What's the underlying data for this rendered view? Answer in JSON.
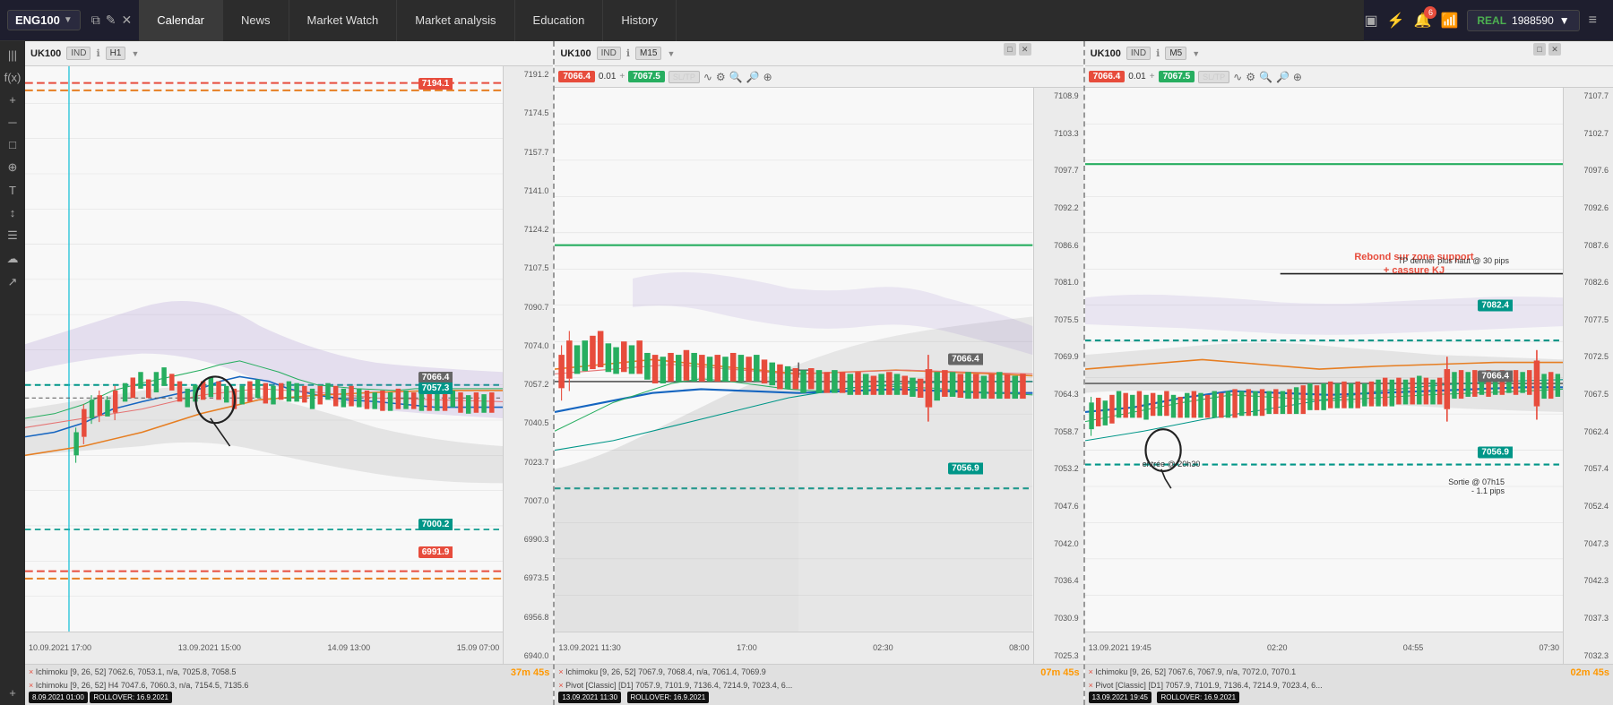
{
  "topbar": {
    "instrument": "ENG100",
    "nav_items": [
      "Calendar",
      "News",
      "Market Watch",
      "Market analysis",
      "Education",
      "History"
    ],
    "account_type": "REAL",
    "account_balance": "1988590",
    "notification_count": "6"
  },
  "charts": [
    {
      "id": "chart1",
      "symbol": "UK100",
      "type": "IND",
      "timeframe": "H1",
      "bid": "",
      "spread": "",
      "ask": "",
      "has_trade_toolbar": false,
      "y_labels": [
        "7191.2",
        "7174.5",
        "7157.7",
        "7141.0",
        "7124.2",
        "7107.5",
        "7090.7",
        "7074.0",
        "7057.2",
        "7040.5",
        "7023.7",
        "7007.0",
        "6990.3",
        "6973.5",
        "6956.8",
        "6940.0"
      ],
      "x_labels": [
        "10.09.2021 17:00",
        "13.09.2021 15:00",
        "14.09.13:00",
        "15.09 07:00"
      ],
      "price_labels": [
        {
          "value": "7194.1",
          "type": "red",
          "top_pct": 5
        },
        {
          "value": "7057.3",
          "type": "teal",
          "top_pct": 56
        },
        {
          "value": "7000.2",
          "type": "teal-dark",
          "top_pct": 82
        },
        {
          "value": "6991.9",
          "type": "red",
          "top_pct": 87
        }
      ],
      "current_price": "7066.4",
      "footer": [
        "× Ichimoku [9, 26, 52] 7062.6, 7053.1, n/a, 7025.8, 7058.5",
        "× Ichimoku [9, 26, 52] H4 7047.6, 7060.3, n/a, 7154.5, 7135.6"
      ],
      "footer_date": "8.09.2021 01:00",
      "footer_rollover": "ROLLOVER: 16.9.2021",
      "timer": "37m 45s",
      "timer_label": "37m 45s"
    },
    {
      "id": "chart2",
      "symbol": "UK100",
      "type": "IND",
      "timeframe": "M15",
      "bid": "7066.4",
      "spread": "0.01",
      "ask": "7067.5",
      "has_trade_toolbar": true,
      "y_labels": [
        "7108.9",
        "7103.3",
        "7097.7",
        "7092.2",
        "7086.6",
        "7081.0",
        "7075.5",
        "7069.9",
        "7064.3",
        "7058.7",
        "7053.2",
        "7047.6",
        "7042.0",
        "7036.4",
        "7030.9",
        "7025.3"
      ],
      "x_labels": [
        "13.09.2021 11:30",
        "17:00",
        "02:30",
        "08:00"
      ],
      "price_labels": [
        {
          "value": "7066.4",
          "type": "gray",
          "top_pct": 56
        },
        {
          "value": "7056.9",
          "type": "teal",
          "top_pct": 67
        }
      ],
      "footer": [
        "× Ichimoku [9, 26, 52] 7067.9, 7068.4, n/a, 7061.4, 7069.9",
        "× Pivot [Classic] [D1] 7057.9, 7101.9, 7136.4, 7214.9, 7023.4, 6..."
      ],
      "footer_date": "13.09.2021 11:30",
      "footer_rollover": "ROLLOVER: 16.9.2021",
      "timer": "07m 45s"
    },
    {
      "id": "chart3",
      "symbol": "UK100",
      "type": "IND",
      "timeframe": "M5",
      "bid": "7066.4",
      "spread": "0.01",
      "ask": "7067.5",
      "has_trade_toolbar": true,
      "y_labels": [
        "7107.7",
        "7102.7",
        "7097.6",
        "7092.6",
        "7087.6",
        "7082.6",
        "7077.5",
        "7072.5",
        "7067.5",
        "7062.4",
        "7057.4",
        "7052.4",
        "7047.3",
        "7042.3",
        "7037.3",
        "7032.3"
      ],
      "x_labels": [
        "13.09.2021 19:45",
        "02:20",
        "04:55",
        "07:30"
      ],
      "price_labels": [
        {
          "value": "7082.4",
          "type": "teal",
          "top_pct": 38
        },
        {
          "value": "7066.4",
          "type": "gray",
          "top_pct": 56
        },
        {
          "value": "7056.9",
          "type": "teal",
          "top_pct": 68
        }
      ],
      "annotation": "Rebond sur zone support\n+ cassure KJ",
      "annotation_tp": "TP dernier plus haut @ 30 pips",
      "annotation_entry": "entrée @ 20h30",
      "annotation_exit": "Sortie @ 07h15\n- 1.1 pips",
      "footer": [
        "× Ichimoku [9, 26, 52] 7067.6, 7067.9, n/a, 7072.0, 7070.1",
        "× Pivot [Classic] [D1] 7057.9, 7101.9, 7136.4, 7214.9, 7023.4, 6..."
      ],
      "footer_date": "13.09.2021 19:45",
      "footer_rollover": "ROLLOVER: 16.9.2021",
      "timer": "02m 45s"
    }
  ],
  "sidebar_tools": [
    "|||",
    "f(x)",
    "+",
    "─",
    "[ ]",
    "⊕",
    "T",
    "↕",
    "☰",
    "☁",
    "↗"
  ],
  "icons": {
    "monitor": "▣",
    "signal": "📶",
    "bell": "🔔",
    "wifi": "📡",
    "menu": "≡",
    "pencil": "✎",
    "zoom_in": "🔍",
    "zoom_out": "🔎",
    "crosshair": "⊕"
  }
}
